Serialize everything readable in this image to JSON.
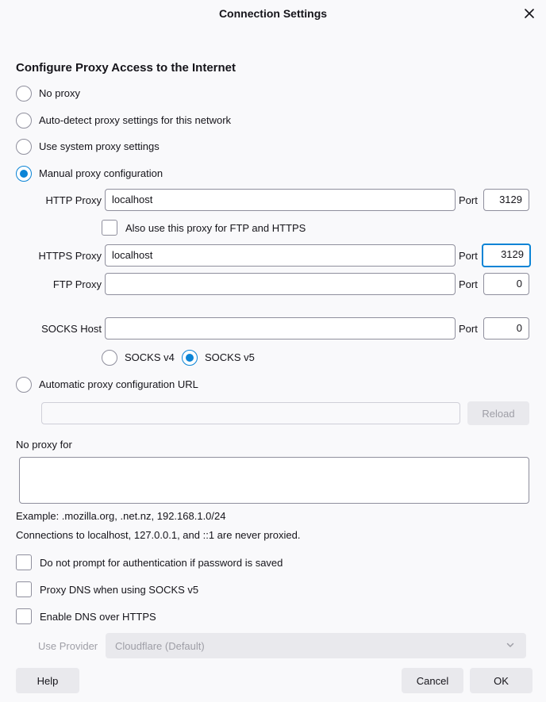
{
  "window": {
    "title": "Connection Settings"
  },
  "heading": "Configure Proxy Access to the Internet",
  "proxy_modes": {
    "no_proxy": "No proxy",
    "auto_detect": "Auto-detect proxy settings for this network",
    "system": "Use system proxy settings",
    "manual": "Manual proxy configuration",
    "pac": "Automatic proxy configuration URL",
    "selected": "manual"
  },
  "manual": {
    "http_label": "HTTP Proxy",
    "http_value": "localhost",
    "http_port_label": "Port",
    "http_port": "3129",
    "also_use_label": "Also use this proxy for FTP and HTTPS",
    "https_label": "HTTPS Proxy",
    "https_value": "localhost",
    "https_port_label": "Port",
    "https_port": "3129",
    "ftp_label": "FTP Proxy",
    "ftp_value": "",
    "ftp_port_label": "Port",
    "ftp_port": "0",
    "socks_label": "SOCKS Host",
    "socks_value": "",
    "socks_port_label": "Port",
    "socks_port": "0",
    "socks_v4": "SOCKS v4",
    "socks_v5": "SOCKS v5",
    "socks_selected": "v5"
  },
  "pac": {
    "url_value": "",
    "reload_label": "Reload"
  },
  "no_proxy": {
    "label": "No proxy for",
    "value": "",
    "example": "Example: .mozilla.org, .net.nz, 192.168.1.0/24",
    "note": "Connections to localhost, 127.0.0.1, and ::1 are never proxied."
  },
  "options": {
    "no_prompt_auth": "Do not prompt for authentication if password is saved",
    "proxy_dns": "Proxy DNS when using SOCKS v5",
    "dns_over_https": "Enable DNS over HTTPS"
  },
  "doh": {
    "provider_label": "Use Provider",
    "provider_value": "Cloudflare (Default)"
  },
  "footer": {
    "help": "Help",
    "cancel": "Cancel",
    "ok": "OK"
  },
  "colors": {
    "accent": "#0a84d6",
    "button_bg": "#e9e9ed",
    "window_bg": "#f9f9fb"
  },
  "icons": {
    "close": "close-icon",
    "dropdown": "chevron-down-icon"
  }
}
